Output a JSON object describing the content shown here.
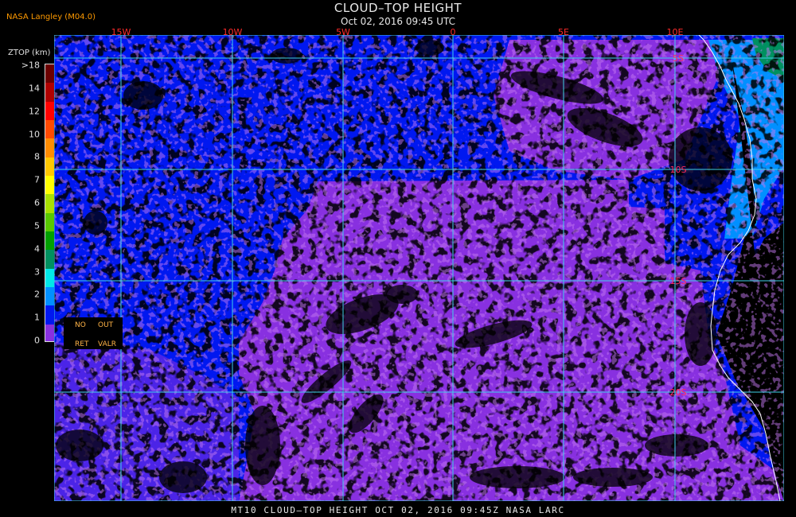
{
  "header": {
    "title": "CLOUD–TOP HEIGHT",
    "subtitle": "Oct 02, 2016 09:45 UTC",
    "provider": "NASA Langley (M04.0)"
  },
  "legend": {
    "title": "ZTOP (km)",
    "labels": [
      ">18",
      "14",
      "12",
      "10",
      "8",
      "7",
      "6",
      "5",
      "4",
      "3",
      "2",
      "1",
      "0"
    ],
    "colors": [
      "#6b0000",
      "#b00000",
      "#ff0000",
      "#ff4a00",
      "#ff8c00",
      "#ffc800",
      "#ffff00",
      "#a8e000",
      "#58c800",
      "#00a000",
      "#009060",
      "#00e8e8",
      "#0090ff",
      "#0018f0",
      "#8830e0"
    ],
    "no_ret": [
      "NO",
      "RET"
    ],
    "out_valr": [
      "OUT",
      "VALR"
    ]
  },
  "colors": {
    "level_0_1": "#8830e0",
    "level_1_2": "#0018f0",
    "level_2_3": "#0090ff",
    "level_3_4": "#00e8e8",
    "level_4_5": "#009060",
    "no_retrieval": "#000000",
    "grid": "#40d0e8",
    "coastline": "#ffffff",
    "lon_label": "#ff2a2a",
    "lat_label": "#ff2a5a"
  },
  "map": {
    "lon_labels": [
      "15W",
      "10W",
      "5W",
      "0",
      "5E",
      "10E"
    ],
    "lat_labels": [
      "5S",
      "10S",
      "15S",
      "20S"
    ]
  },
  "footer": {
    "caption": "MT10  CLOUD–TOP HEIGHT   OCT 02, 2016 09:45Z   NASA LARC"
  }
}
